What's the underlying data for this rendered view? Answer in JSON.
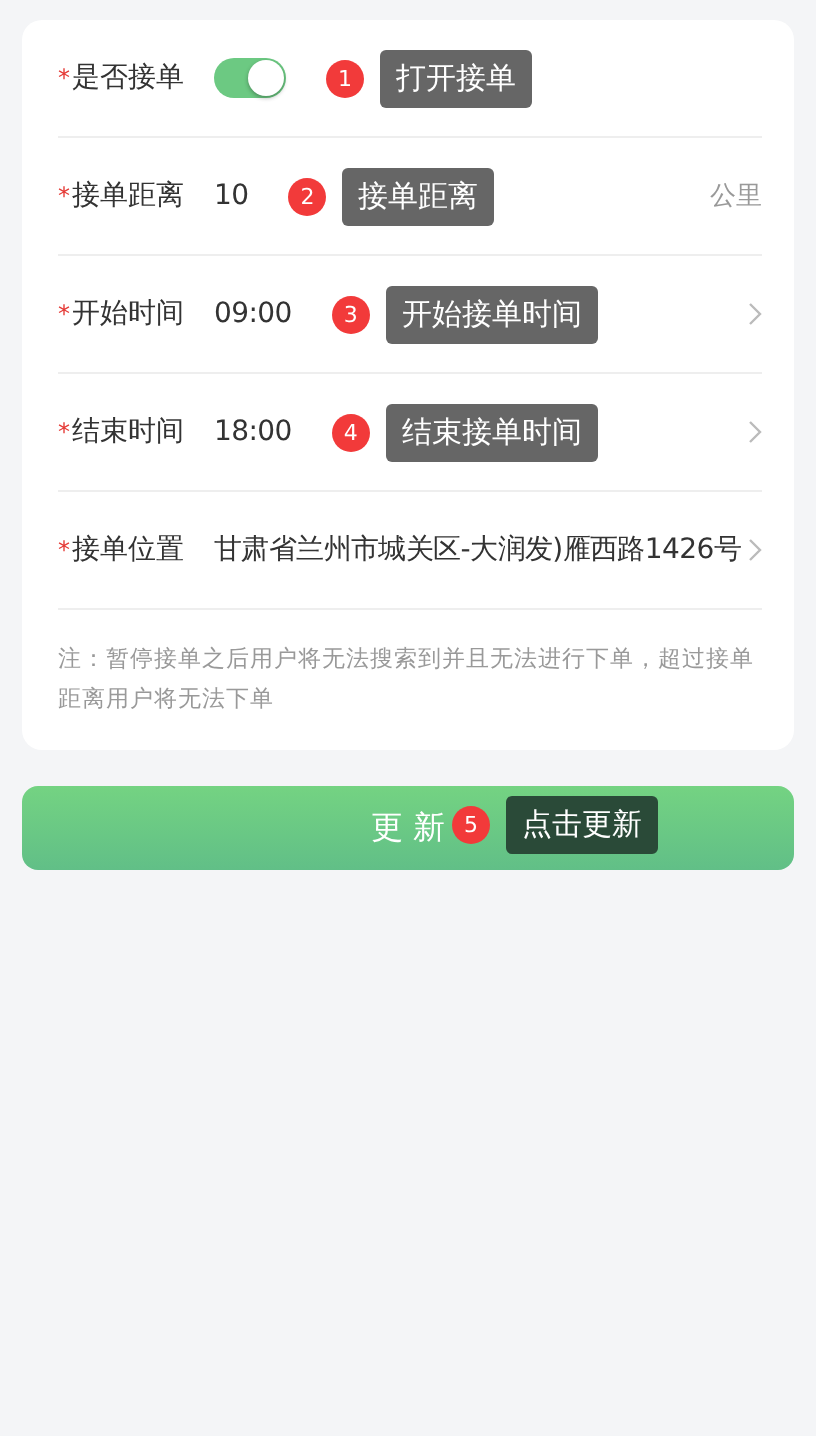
{
  "form": {
    "fields": [
      {
        "kind": "toggle",
        "label": "是否接单",
        "required_mark": "*",
        "on": true,
        "annotation": {
          "number": "1",
          "text": "打开接单",
          "color": "#666666"
        }
      },
      {
        "kind": "input",
        "label": "接单距离",
        "required_mark": "*",
        "value": "10",
        "unit": "公里",
        "annotation": {
          "number": "2",
          "text": "接单距离",
          "color": "#666666"
        }
      },
      {
        "kind": "picker",
        "label": "开始时间",
        "required_mark": "*",
        "value": "09:00",
        "annotation": {
          "number": "3",
          "text": "开始接单时间",
          "color": "#666666"
        }
      },
      {
        "kind": "picker",
        "label": "结束时间",
        "required_mark": "*",
        "value": "18:00",
        "annotation": {
          "number": "4",
          "text": "结束接单时间",
          "color": "#666666"
        }
      },
      {
        "kind": "picker",
        "label": "接单位置",
        "required_mark": "*",
        "value": "甘肃省兰州市城关区-大润发)雁西路1426号"
      }
    ],
    "note": "注：暂停接单之后用户将无法搜索到并且无法进行下单，超过接单距离用户将无法下单"
  },
  "update_button": {
    "label": "更 新",
    "annotation": {
      "number": "5",
      "text": "点击更新",
      "color": "#2a4a38"
    }
  }
}
